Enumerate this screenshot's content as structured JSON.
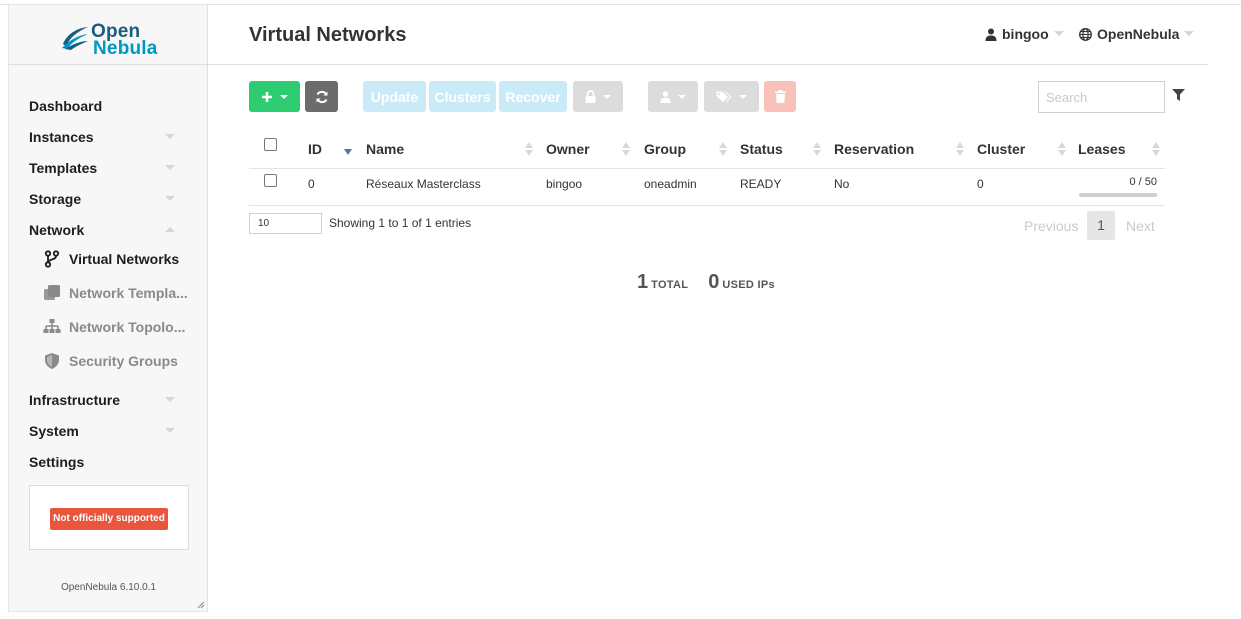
{
  "app": {
    "logo_line1": "Open",
    "logo_line2": "Nebula",
    "version": "OpenNebula 6.10.0.1",
    "support_badge": "Not officially supported"
  },
  "sidebar": {
    "items": [
      {
        "label": "Dashboard"
      },
      {
        "label": "Instances"
      },
      {
        "label": "Templates"
      },
      {
        "label": "Storage"
      },
      {
        "label": "Network"
      },
      {
        "label": "Infrastructure"
      },
      {
        "label": "System"
      },
      {
        "label": "Settings"
      }
    ],
    "network_subitems": [
      {
        "label": "Virtual Networks",
        "icon": "code-fork-icon",
        "active": true
      },
      {
        "label": "Network Templa...",
        "icon": "clone-icon",
        "active": false
      },
      {
        "label": "Network Topolo...",
        "icon": "sitemap-icon",
        "active": false
      },
      {
        "label": "Security Groups",
        "icon": "shield-icon",
        "active": false
      }
    ]
  },
  "header": {
    "title": "Virtual Networks",
    "user": "bingoo",
    "zone": "OpenNebula"
  },
  "toolbar": {
    "update_label": "Update",
    "clusters_label": "Clusters",
    "recover_label": "Recover",
    "search_placeholder": "Search"
  },
  "table": {
    "columns": [
      "ID",
      "Name",
      "Owner",
      "Group",
      "Status",
      "Reservation",
      "Cluster",
      "Leases"
    ],
    "rows": [
      {
        "id": "0",
        "name": "Réseaux Masterclass",
        "owner": "bingoo",
        "group": "oneadmin",
        "status": "READY",
        "reservation": "No",
        "cluster": "0",
        "leases": "0 / 50",
        "leases_used_fraction": 0
      }
    ]
  },
  "pagination": {
    "page_length": "10",
    "info": "Showing 1 to 1 of 1 entries",
    "previous": "Previous",
    "current": "1",
    "next": "Next"
  },
  "summary": {
    "total_value": "1",
    "total_label": "TOTAL",
    "used_value": "0",
    "used_label": "USED IPs"
  },
  "colors": {
    "create": "#2ecc71",
    "refresh": "#6c6c6c",
    "support_badge": "#e9553d",
    "logo": "#0098c3"
  }
}
